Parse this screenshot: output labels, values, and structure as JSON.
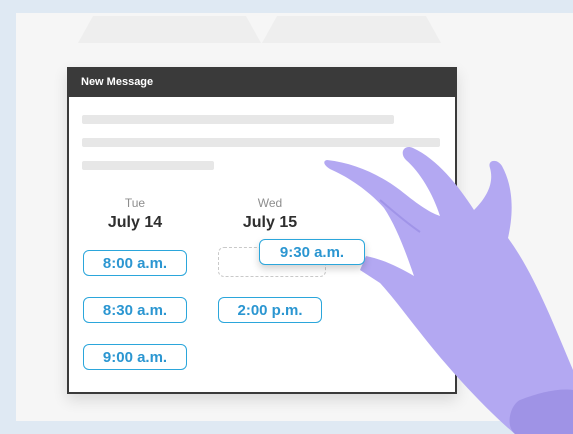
{
  "window": {
    "title": "New Message"
  },
  "calendar": {
    "days": [
      {
        "day": "Tue",
        "date": "July 14"
      },
      {
        "day": "Wed",
        "date": "July 15"
      }
    ],
    "tuesday_slots": [
      "8:00 a.m.",
      "8:30 a.m.",
      "9:00 a.m."
    ],
    "wednesday_slots": [
      "2:00 p.m."
    ],
    "dragging_slot": "9:30 a.m."
  },
  "colors": {
    "slot_border": "#2ba6db",
    "slot_text": "#2b96d1",
    "titlebar": "#3a3a3a",
    "hand": "#b3a8f2"
  },
  "icons": {
    "hand": "gloved-hand-icon"
  }
}
